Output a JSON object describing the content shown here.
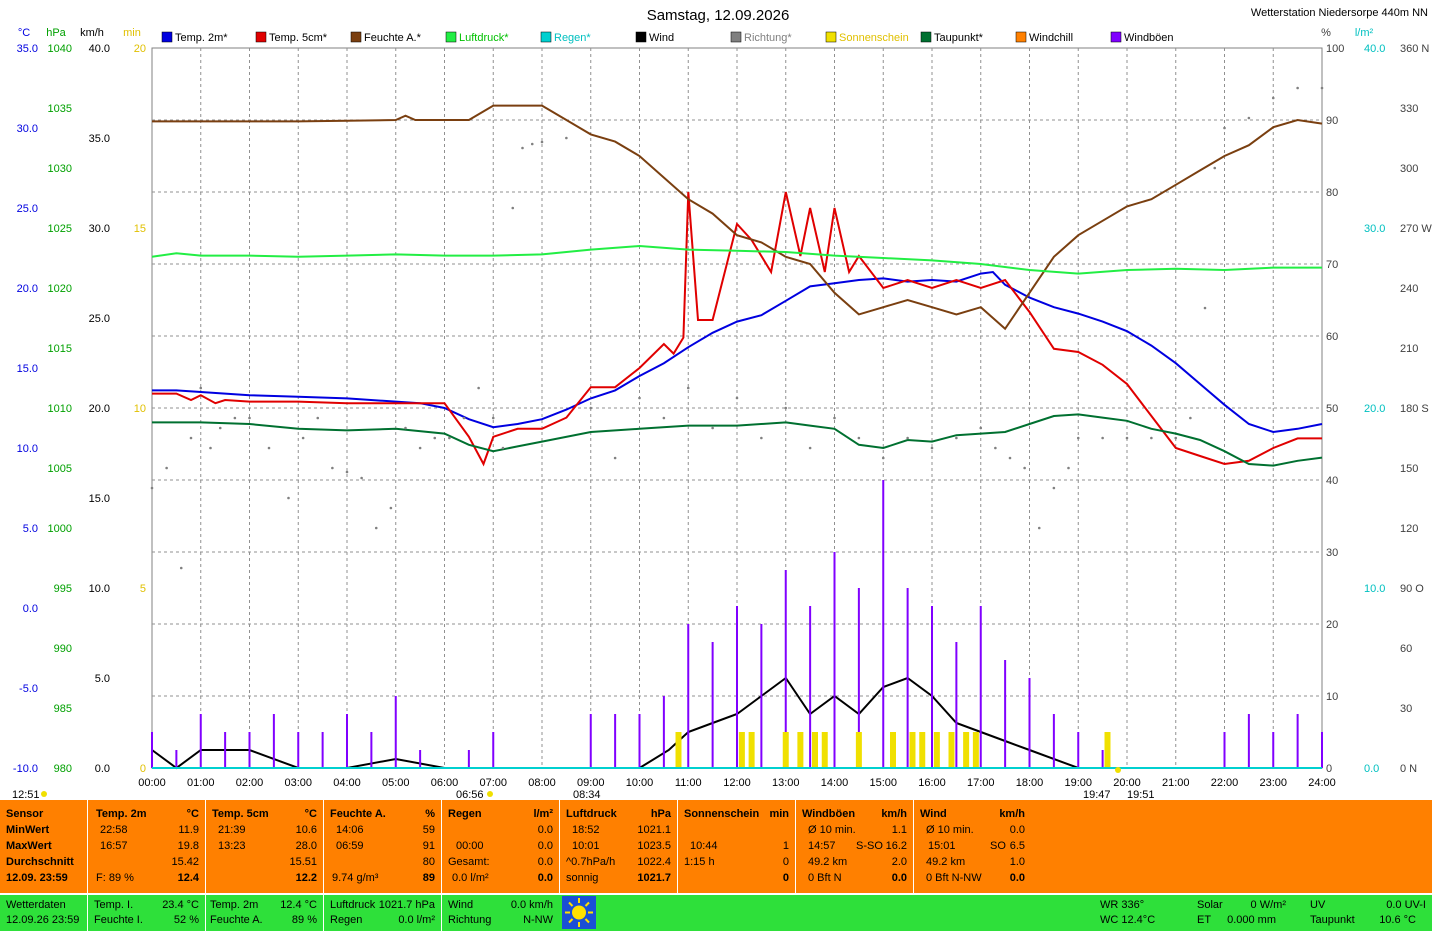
{
  "header": {
    "title": "Samstag, 12.09.2026",
    "station": "Wetterstation Niedersorpe 440m NN"
  },
  "colors": {
    "temp2m": "#0000e0",
    "temp5cm": "#e00000",
    "humidity": "#7a3f10",
    "pressure": "#22ee44",
    "rain": "#00d0d0",
    "wind": "#000000",
    "direction": "#808080",
    "sunshine": "#f0e000",
    "dewpoint": "#007030",
    "windchill": "#ff8000",
    "gusts": "#8000ff",
    "panel_orange": "#ff8000",
    "panel_green": "#2ee03a"
  },
  "chart_data": {
    "type": "line",
    "x_unit": "hours",
    "x_range": [
      0,
      24
    ],
    "x_ticks": [
      "00:00",
      "01:00",
      "02:00",
      "03:00",
      "04:00",
      "05:00",
      "06:00",
      "07:00",
      "08:00",
      "09:00",
      "10:00",
      "11:00",
      "12:00",
      "13:00",
      "14:00",
      "15:00",
      "16:00",
      "17:00",
      "18:00",
      "19:00",
      "20:00",
      "21:00",
      "22:00",
      "23:00",
      "24:00"
    ],
    "axes": [
      {
        "unit": "°C",
        "color": "#0000e0",
        "range": [
          -10,
          35
        ],
        "ticks": [
          "35.0",
          "30.0",
          "25.0",
          "20.0",
          "15.0",
          "10.0",
          "5.0",
          "0.0",
          "-5.0",
          "-10.0"
        ]
      },
      {
        "unit": "hPa",
        "color": "#00a000",
        "range": [
          980,
          1040
        ],
        "ticks": [
          "1040",
          "1035",
          "1030",
          "1025",
          "1020",
          "1015",
          "1010",
          "1005",
          "1000",
          "995",
          "990",
          "985",
          "980"
        ]
      },
      {
        "unit": "km/h",
        "color": "#000000",
        "range": [
          0,
          40
        ],
        "ticks": [
          "40.0",
          "35.0",
          "30.0",
          "25.0",
          "20.0",
          "15.0",
          "10.0",
          "5.0",
          "0.0"
        ]
      },
      {
        "unit": "min",
        "color": "#e0c000",
        "range": [
          0,
          20
        ],
        "ticks": [
          "20",
          "15",
          "10",
          "5",
          "0"
        ]
      },
      {
        "unit": "%",
        "color": "#404040",
        "range": [
          0,
          100
        ],
        "ticks": [
          "100",
          "90",
          "80",
          "70",
          "60",
          "50",
          "40",
          "30",
          "20",
          "10",
          "0"
        ]
      },
      {
        "unit": "l/m²",
        "color": "#00c0c0",
        "range": [
          0,
          40
        ],
        "ticks": [
          "40.0",
          "30.0",
          "20.0",
          "10.0",
          "0.0"
        ]
      },
      {
        "unit": "",
        "color": "#404040",
        "range": [
          0,
          360
        ],
        "ticks": [
          "360 N",
          "330",
          "300",
          "270 W",
          "240",
          "210",
          "180 S",
          "150",
          "120",
          "90 O",
          "60",
          "30",
          "0 N"
        ]
      }
    ],
    "legend": [
      "Temp. 2m*",
      "Temp. 5cm*",
      "Feuchte A.*",
      "Luftdruck*",
      "Regen*",
      "Wind",
      "Richtung*",
      "Sonnenschein",
      "Taupunkt*",
      "Windchill",
      "Windböen"
    ],
    "series": [
      {
        "name": "Temp. 2m*",
        "axis": "°C",
        "color": "#0000e0",
        "x": [
          0,
          0.5,
          1,
          2,
          3,
          4,
          5,
          5.5,
          6,
          6.5,
          7,
          7.5,
          8,
          8.5,
          9,
          9.5,
          10,
          10.5,
          11,
          11.5,
          12,
          12.5,
          13,
          13.5,
          14,
          14.5,
          15,
          15.5,
          16,
          16.5,
          17,
          17.25,
          17.5,
          18,
          18.5,
          19,
          19.5,
          20,
          20.5,
          21,
          21.5,
          22,
          22.5,
          23,
          23.5,
          24
        ],
        "y": [
          13.6,
          13.6,
          13.5,
          13.3,
          13.2,
          13.1,
          12.9,
          12.8,
          12.5,
          11.8,
          11.3,
          11.5,
          11.8,
          12.4,
          13.1,
          13.6,
          14.5,
          15.3,
          16.3,
          17.2,
          17.9,
          18.3,
          19.2,
          20.1,
          20.3,
          20.5,
          20.6,
          20.4,
          20.5,
          20.4,
          20.9,
          21.0,
          20.2,
          19.4,
          18.8,
          18.4,
          17.9,
          17.3,
          16.4,
          15.3,
          14.0,
          12.7,
          11.5,
          11.0,
          11.2,
          11.5
        ]
      },
      {
        "name": "Temp. 5cm*",
        "axis": "°C",
        "color": "#e00000",
        "x": [
          0,
          0.5,
          0.8,
          1,
          1.3,
          1.5,
          2,
          3,
          4,
          5,
          6,
          6.5,
          6.8,
          7,
          7.5,
          8,
          8.5,
          9,
          9.5,
          10,
          10.5,
          10.7,
          10.9,
          11,
          11.2,
          11.5,
          12,
          12.3,
          12.7,
          13,
          13.3,
          13.5,
          13.8,
          14,
          14.3,
          14.5,
          15,
          15.5,
          16,
          16.5,
          17,
          17.5,
          18,
          18.5,
          19,
          19.5,
          20,
          20.5,
          21,
          21.5,
          22,
          22.5,
          23,
          23.5,
          24
        ],
        "y": [
          13.4,
          13.4,
          13.0,
          13.3,
          12.8,
          13.0,
          12.9,
          12.9,
          12.8,
          12.8,
          12.8,
          10.7,
          9.0,
          10.7,
          11.2,
          11.2,
          11.9,
          13.8,
          13.8,
          15.0,
          16.5,
          15.9,
          16.9,
          26.0,
          18.0,
          18.0,
          24.0,
          23.0,
          21.0,
          26.0,
          22.0,
          25.0,
          21.0,
          25.0,
          21.0,
          22.0,
          20.0,
          20.5,
          20.0,
          20.5,
          20.0,
          20.5,
          18.5,
          16.2,
          16.0,
          15.2,
          14.0,
          12.0,
          10.0,
          9.5,
          9.0,
          9.2,
          10.0,
          10.6,
          10.6
        ]
      },
      {
        "name": "Feuchte A.*",
        "axis": "%",
        "color": "#7a3f10",
        "x": [
          0,
          1,
          2,
          3,
          4,
          5,
          5.2,
          5.4,
          6,
          6.5,
          7,
          7.5,
          8,
          8.5,
          9,
          9.5,
          10,
          10.5,
          11,
          11.5,
          12,
          12.5,
          13,
          13.5,
          14,
          14.5,
          15,
          15.5,
          16,
          16.5,
          17,
          17.5,
          18,
          18.5,
          19,
          19.5,
          20,
          20.5,
          21,
          21.5,
          22,
          22.5,
          23,
          23.5,
          24
        ],
        "y": [
          89.8,
          89.8,
          89.8,
          89.8,
          89.9,
          90,
          90.6,
          90,
          90,
          90,
          92,
          92,
          92,
          90,
          88,
          87,
          85,
          82,
          79,
          77,
          74,
          73,
          71,
          70,
          66,
          63,
          64,
          65,
          64,
          63,
          64,
          61,
          66,
          71,
          74,
          76,
          78,
          79,
          81,
          83,
          85,
          86.5,
          89,
          90,
          89.5
        ]
      },
      {
        "name": "Luftdruck*",
        "axis": "hPa",
        "color": "#22ee44",
        "x": [
          0,
          0.5,
          1,
          2,
          3,
          4,
          5,
          6,
          7,
          8,
          9,
          10,
          11,
          12,
          13,
          14,
          15,
          16,
          17,
          18,
          19,
          20,
          21,
          22,
          23,
          24
        ],
        "y": [
          1022.6,
          1022.9,
          1022.7,
          1022.7,
          1022.6,
          1022.7,
          1022.8,
          1022.7,
          1022.7,
          1022.8,
          1023.2,
          1023.5,
          1023.2,
          1023.1,
          1023.0,
          1022.7,
          1022.5,
          1022.3,
          1022.0,
          1021.5,
          1021.2,
          1021.5,
          1021.6,
          1021.5,
          1021.7,
          1021.7
        ]
      },
      {
        "name": "Taupunkt*",
        "axis": "°C",
        "color": "#007030",
        "x": [
          0,
          1,
          2,
          3,
          4,
          5,
          6,
          6.5,
          7,
          7.5,
          8,
          9,
          10,
          11,
          12,
          13,
          13.5,
          14,
          14.5,
          15,
          15.5,
          16,
          16.5,
          17,
          17.5,
          18,
          18.5,
          19,
          19.5,
          20,
          20.5,
          21,
          21.5,
          22,
          22.5,
          23,
          23.5,
          24
        ],
        "y": [
          11.6,
          11.6,
          11.5,
          11.2,
          11.1,
          11.2,
          10.9,
          10.2,
          9.8,
          10.1,
          10.4,
          11.0,
          11.2,
          11.4,
          11.4,
          11.6,
          11.4,
          11.2,
          10.2,
          10.0,
          10.5,
          10.4,
          10.8,
          10.9,
          11.0,
          11.5,
          12.0,
          12.1,
          11.9,
          11.7,
          11.2,
          10.9,
          10.5,
          9.8,
          9.0,
          8.9,
          9.2,
          9.4
        ]
      },
      {
        "name": "Richtung*",
        "axis": "",
        "color": "#808080",
        "x": [
          0,
          0.3,
          0.6,
          0.8,
          1,
          1.2,
          1.4,
          1.7,
          2,
          2.4,
          2.8,
          3.1,
          3.4,
          3.7,
          4,
          4.3,
          4.6,
          4.9,
          5.2,
          5.5,
          5.8,
          6.1,
          6.4,
          6.7,
          7,
          7.2,
          7.4,
          7.6,
          7.8,
          8,
          8.5,
          9,
          9.5,
          10,
          10.5,
          11,
          11.5,
          12,
          12.5,
          13,
          13.5,
          14,
          14.5,
          15,
          15.5,
          16,
          16.5,
          17,
          17.3,
          17.6,
          17.9,
          18.2,
          18.5,
          18.8,
          19,
          19.5,
          20,
          20.5,
          21,
          21.3,
          21.6,
          21.8,
          22,
          22.5,
          23,
          23.5,
          24
        ],
        "y": [
          140,
          150,
          100,
          165,
          190,
          160,
          170,
          175,
          175,
          160,
          135,
          165,
          175,
          150,
          148,
          145,
          120,
          130,
          170,
          160,
          165,
          165,
          175,
          190,
          175,
          160,
          280,
          310,
          312,
          313,
          315,
          180,
          155,
          185,
          175,
          190,
          170,
          185,
          165,
          180,
          160,
          175,
          165,
          155,
          165,
          160,
          165,
          170,
          160,
          155,
          150,
          120,
          140,
          150,
          165,
          165,
          165,
          165,
          165,
          175,
          230,
          300,
          320,
          325,
          335,
          340,
          340
        ]
      },
      {
        "name": "Wind",
        "axis": "km/h",
        "color": "#000000",
        "x": [
          0,
          0.5,
          1,
          2,
          3,
          4,
          5,
          6,
          7,
          8,
          9,
          10,
          10.6,
          11,
          11.5,
          12,
          12.5,
          13,
          13.5,
          14,
          14.5,
          15,
          15.5,
          16,
          16.5,
          17,
          17.5,
          18,
          19,
          20,
          21,
          22,
          23,
          24
        ],
        "y": [
          1,
          0,
          1,
          1,
          0,
          0,
          0.5,
          0,
          0,
          0,
          0,
          0,
          1,
          2,
          2.5,
          3,
          4,
          5,
          3,
          4,
          3,
          4.5,
          5,
          4,
          2.5,
          2,
          1.5,
          1,
          0,
          0,
          0,
          0,
          0,
          0
        ]
      },
      {
        "name": "Windböen",
        "axis": "km/h",
        "color": "#8000ff",
        "x": [
          0,
          0.5,
          1,
          1.5,
          2,
          2.5,
          3,
          3.5,
          4,
          4.5,
          5,
          5.5,
          6,
          6.5,
          7,
          7.5,
          8,
          8.5,
          9,
          9.5,
          10,
          10.5,
          11,
          11.5,
          12,
          12.5,
          13,
          13.5,
          14,
          14.5,
          15,
          15.5,
          16,
          16.5,
          17,
          17.5,
          18,
          18.5,
          19,
          19.5,
          20,
          20.5,
          21,
          21.5,
          22,
          22.5,
          23,
          23.5,
          24
        ],
        "y": [
          2,
          1,
          3,
          2,
          2,
          3,
          2,
          2,
          3,
          2,
          4,
          1,
          0,
          1,
          2,
          0,
          0,
          0,
          3,
          3,
          3,
          4,
          8,
          7,
          9,
          8,
          11,
          9,
          12,
          10,
          16,
          10,
          9,
          7,
          9,
          6,
          5,
          3,
          2,
          1,
          0,
          0,
          0,
          0,
          2,
          3,
          2,
          3,
          2
        ]
      },
      {
        "name": "Sonnenschein",
        "axis": "min",
        "color": "#f0e000",
        "x": [
          10.8,
          11.0,
          12.1,
          12.3,
          13.0,
          13.3,
          13.6,
          13.8,
          14.5,
          15.2,
          15.6,
          15.8,
          16.1,
          16.4,
          16.7,
          16.9,
          19.6
        ],
        "y": [
          1,
          0,
          1,
          1,
          1,
          1,
          1,
          1,
          1,
          1,
          1,
          1,
          1,
          1,
          1,
          1,
          1
        ]
      }
    ]
  },
  "chart_labels": {
    "sunrise_time": "06:56",
    "sunset_time": "19:47",
    "twilight_time": "19:51",
    "solar_time": "08:34",
    "left_time": "12:51"
  },
  "panel": {
    "sensor": {
      "label": "Sensor",
      "min": "MinWert",
      "max": "MaxWert",
      "avg": "Durchschnitt",
      "stamp": "12.09. 23:59"
    },
    "temp2m": {
      "title": "Temp. 2m",
      "unit": "°C",
      "min_time": "22:58",
      "min_val": "11.9",
      "max_time": "16:57",
      "max_val": "19.8",
      "avg": "15.42",
      "f_label": "F: 89 %",
      "cur": "12.4"
    },
    "temp5cm": {
      "title": "Temp. 5cm",
      "unit": "°C",
      "min_time": "21:39",
      "min_val": "10.6",
      "max_time": "13:23",
      "max_val": "28.0",
      "avg": "15.51",
      "cur": "12.2"
    },
    "humidity": {
      "title": "Feuchte A.",
      "unit": "%",
      "min_time": "14:06",
      "min_val": "59",
      "max_time": "06:59",
      "max_val": "91",
      "avg": "80",
      "abs": "9.74 g/m³",
      "cur": "89"
    },
    "rain": {
      "title": "Regen",
      "unit": "l/m²",
      "time": "00:00",
      "val1": "0.0",
      "gesamt_label": "Gesamt:",
      "gesamt": "0.0",
      "cur_label": "0.0 l/m²",
      "cur": "0.0",
      "blank": "0.0"
    },
    "pressure": {
      "title": "Luftdruck",
      "unit": "hPa",
      "min_time": "18:52",
      "min_val": "1021.1",
      "max_time": "10:01",
      "max_val": "1023.5",
      "trend": "^0.7hPa/h",
      "trend_val": "1022.4",
      "state": "sonnig",
      "cur": "1021.7"
    },
    "sunshine": {
      "title": "Sonnenschein",
      "unit": "min",
      "time": "10:44",
      "val": "1",
      "dur": "1:15 h",
      "dur_val": "0",
      "cur": "0"
    },
    "gusts": {
      "title": "Windböen",
      "unit": "km/h",
      "avg_label": "Ø 10 min.",
      "avg_val": "1.1",
      "max_time": "14:57",
      "max_dir": "S-SO",
      "max_val": "16.2",
      "dist": "49.2 km",
      "dist_val": "2.0",
      "bft": "0 Bft N",
      "cur": "0.0"
    },
    "wind": {
      "title": "Wind",
      "unit": "km/h",
      "avg_label": "Ø 10 min.",
      "avg_val": "0.0",
      "max_time": "15:01",
      "max_dir": "SO",
      "max_val": "6.5",
      "dist": "49.2 km",
      "dist_val": "1.0",
      "bft": "0 Bft N-NW",
      "cur": "0.0"
    }
  },
  "status": {
    "label": "Wetterdaten",
    "stamp": "12.09.26 23:59",
    "temp_i_label": "Temp. I.",
    "temp_i": "23.4 °C",
    "hum_i_label": "Feuchte I.",
    "hum_i": "52 %",
    "temp2m_label": "Temp. 2m",
    "temp2m": "12.4 °C",
    "huma_label": "Feuchte A.",
    "huma": "89 %",
    "press_label": "Luftdruck",
    "press": "1021.7 hPa",
    "rain_label": "Regen",
    "rain": "0.0 l/m²",
    "wind_label": "Wind",
    "wind": "0.0 km/h",
    "dir_label": "Richtung",
    "dir": "N-NW",
    "wr": "WR 336°",
    "wc": "WC 12.4°C",
    "solar_label": "Solar",
    "solar": "0 W/m²",
    "et_label": "ET",
    "et": "0.000 mm",
    "uv_label": "UV",
    "uv": "0.0 UV-I",
    "dew_label": "Taupunkt",
    "dew": "10.6 °C"
  }
}
